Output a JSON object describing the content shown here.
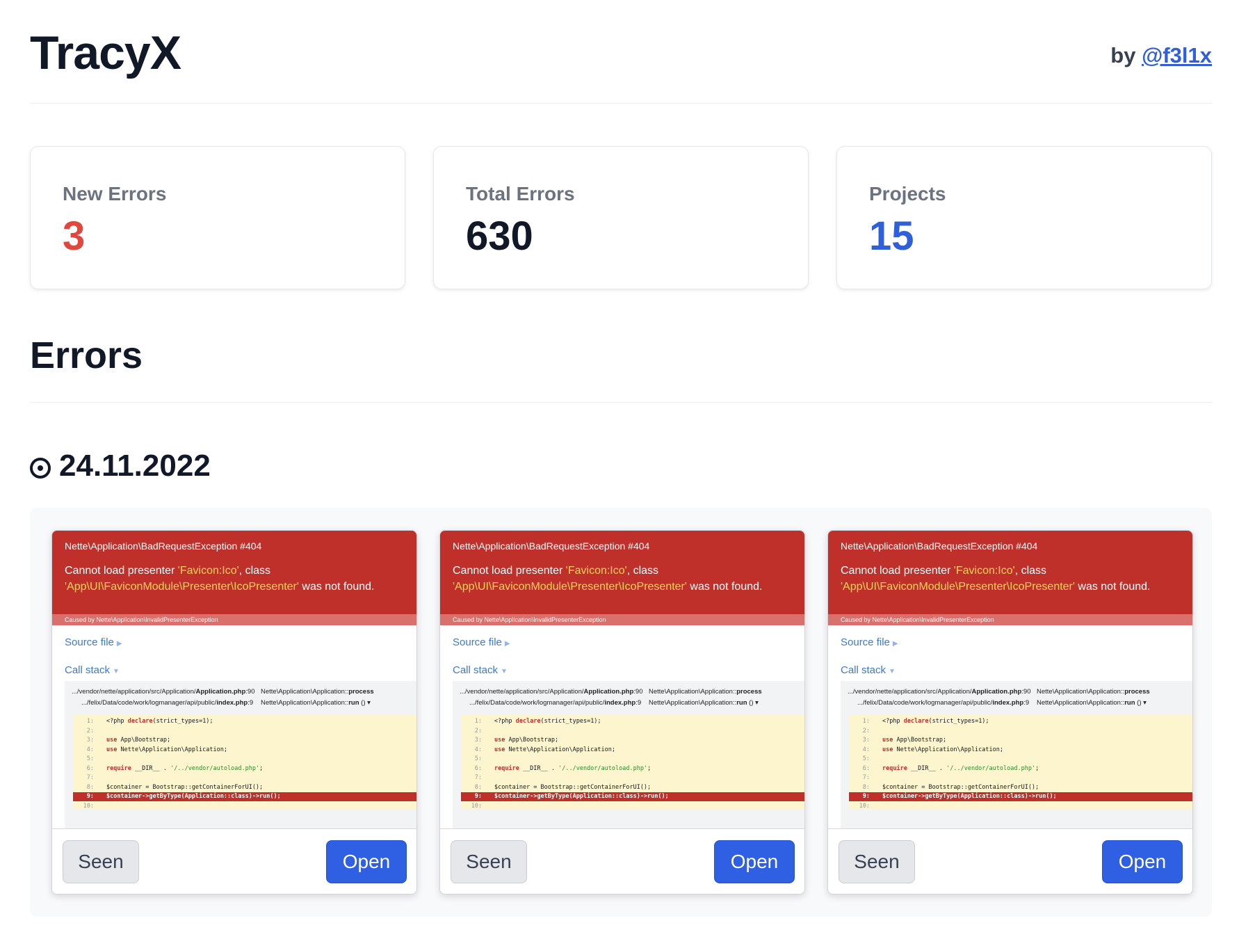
{
  "header": {
    "brand": "TracyX",
    "by_prefix": "by",
    "author": "@f3l1x"
  },
  "stats": [
    {
      "label": "New Errors",
      "value": "3",
      "color": "#e0483e"
    },
    {
      "label": "Total Errors",
      "value": "630",
      "color": "#111827"
    },
    {
      "label": "Projects",
      "value": "15",
      "color": "#2f5fd9"
    }
  ],
  "section": {
    "title": "Errors",
    "date": "24.11.2022"
  },
  "error_template": {
    "title": "Nette\\Application\\BadRequestException #404",
    "msg_1": "Cannot load presenter ",
    "msg_hl1": "'Favicon:Ico'",
    "msg_2": ", class",
    "msg_hl2": "'App\\UI\\FaviconModule\\Presenter\\IcoPresenter'",
    "msg_3": " was not found.",
    "caused": "Caused by Nette\\Application\\InvalidPresenterException",
    "source_label": "Source file",
    "callstack_label": "Call stack",
    "stack": [
      {
        "path": ".../vendor/nette/application/src/Application/",
        "file": "Application.php",
        "line": ":90",
        "fn_prefix": "Nette\\Application\\Application::",
        "fn_name": "process"
      },
      {
        "path": ".../felix/Data/code/work/logmanager/api/public/",
        "file": "index.php",
        "line": ":9",
        "fn_prefix": "Nette\\Application\\Application::",
        "fn_name": "run",
        "fn_suffix": " () ▾"
      }
    ],
    "code": [
      {
        "n": "1:",
        "kw": "",
        "pre": "<?php ",
        "k2": "declare",
        "rest": "(strict_types=1);"
      },
      {
        "n": "2:",
        "pre": "",
        "k2": "",
        "rest": ""
      },
      {
        "n": "3:",
        "pre": "",
        "k2": "use",
        "rest": " App\\Bootstrap;"
      },
      {
        "n": "4:",
        "pre": "",
        "k2": "use",
        "rest": " Nette\\Application\\Application;"
      },
      {
        "n": "5:",
        "pre": "",
        "k2": "",
        "rest": ""
      },
      {
        "n": "6:",
        "pre": "",
        "k2": "require",
        "rest": " __DIR__ . ",
        "str": "'/../vendor/autoload.php'",
        "tail": ";"
      },
      {
        "n": "7:",
        "pre": "",
        "k2": "",
        "rest": ""
      },
      {
        "n": "8:",
        "pre": "$container = Bootstrap::getContainerForUI();",
        "k2": "",
        "rest": ""
      },
      {
        "n": "9:",
        "pre": "$container->getByType(Application::class)->run();",
        "k2": "",
        "rest": "",
        "hi": true
      },
      {
        "n": "10:",
        "pre": "",
        "k2": "",
        "rest": ""
      }
    ],
    "seen_label": "Seen",
    "open_label": "Open"
  },
  "errors_count": 3
}
